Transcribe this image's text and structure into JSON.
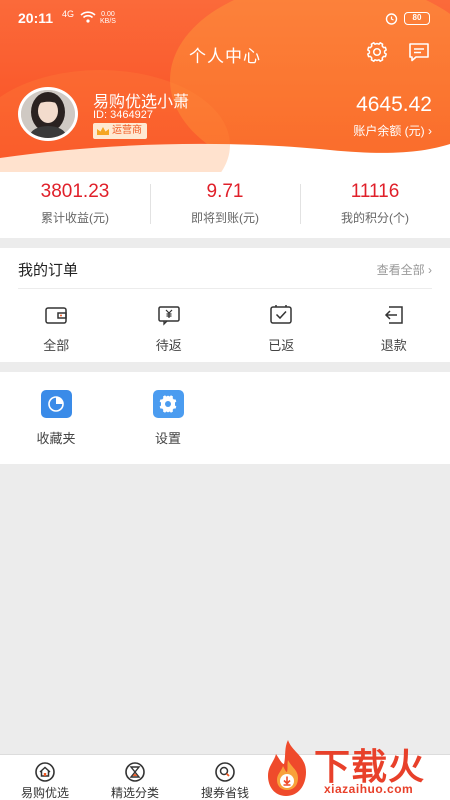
{
  "status_bar": {
    "time": "20:11",
    "signal": "4G",
    "speed_value": "0.00",
    "speed_unit": "KB/S",
    "battery": "80"
  },
  "header": {
    "title": "个人中心",
    "settings_icon": "gear-icon",
    "message_icon": "message-icon"
  },
  "profile": {
    "name": "易购优选小萧",
    "id_text": "ID: 3464927",
    "role": "运营商",
    "balance": "4645.42",
    "balance_label": "账户余额 (元)",
    "balance_chevron": "›"
  },
  "stats": [
    {
      "value": "3801.23",
      "label": "累计收益(元)"
    },
    {
      "value": "9.71",
      "label": "即将到账(元)"
    },
    {
      "value": "11116",
      "label": "我的积分(个)"
    }
  ],
  "orders": {
    "title": "我的订单",
    "view_all": "查看全部 ›",
    "items": [
      {
        "label": "全部",
        "icon": "wallet-icon"
      },
      {
        "label": "待返",
        "icon": "yuan-receipt-icon"
      },
      {
        "label": "已返",
        "icon": "checked-box-icon"
      },
      {
        "label": "退款",
        "icon": "refund-icon"
      }
    ]
  },
  "tools": [
    {
      "label": "收藏夹",
      "icon": "pie-chart-icon"
    },
    {
      "label": "设置",
      "icon": "gear-icon"
    }
  ],
  "bottom_nav": [
    {
      "label": "易购优选",
      "icon": "home-icon"
    },
    {
      "label": "精选分类",
      "icon": "hourglass-icon"
    },
    {
      "label": "搜券省钱",
      "icon": "search-icon"
    }
  ],
  "watermark": {
    "text": "下载火",
    "sub": "xiazaihuo.com"
  },
  "colors": {
    "header_start": "#fb6a3a",
    "header_end": "#f94a24",
    "stat_value": "#e0202a",
    "tool_icon": "#3a8be8",
    "badge_bg": "#ffe9d2"
  }
}
